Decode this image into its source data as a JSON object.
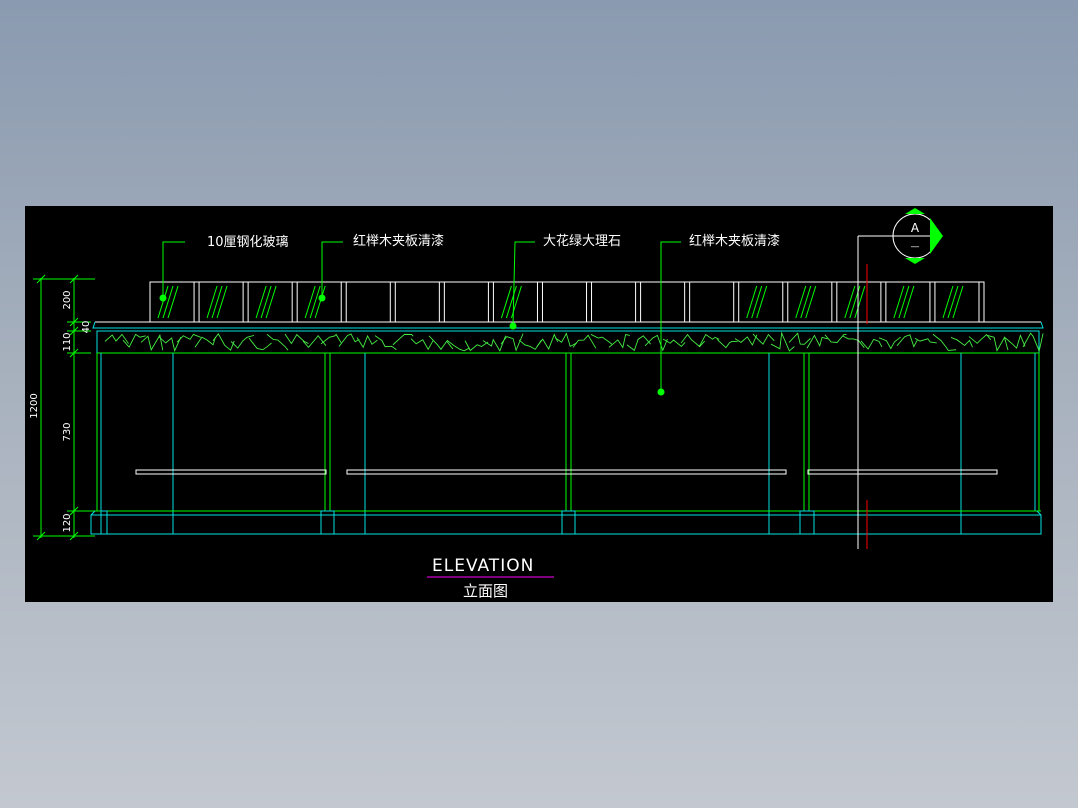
{
  "drawing": {
    "title_en": "ELEVATION",
    "title_cn": "立面图",
    "section_marker": {
      "letter": "A",
      "sub": "—"
    },
    "labels": [
      {
        "id": "glass",
        "text": "10厘钢化玻璃"
      },
      {
        "id": "veneer-top",
        "text": "红榉木夹板清漆"
      },
      {
        "id": "marble",
        "text": "大花绿大理石"
      },
      {
        "id": "veneer-body",
        "text": "红榉木夹板清漆"
      }
    ],
    "dimensions": {
      "total": "1200",
      "segments": [
        "200",
        "40",
        "110",
        "730",
        "120"
      ]
    },
    "colors": {
      "background_outer": "#8a9ab0",
      "drawing_bg": "#000000",
      "linework_green": "#00ff00",
      "linework_cyan": "#00e0e0",
      "marble_green": "#44ee44",
      "section_line_red": "#ff0000",
      "title_underline": "#ff00ff",
      "text": "#ffffff"
    }
  }
}
